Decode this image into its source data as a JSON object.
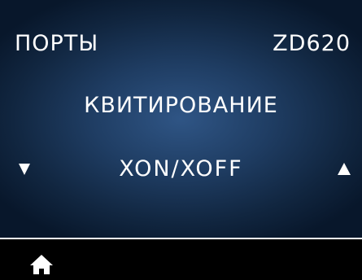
{
  "header": {
    "section": "ПОРТЫ",
    "model": "ZD620"
  },
  "menu": {
    "title": "КВИТИРОВАНИЕ",
    "value": "XON/XOFF"
  },
  "icons": {
    "left_arrow": "down-triangle-icon",
    "right_arrow": "up-triangle-icon",
    "home": "home-icon"
  },
  "colors": {
    "text": "#ffffff",
    "background_center": "#2f5585",
    "background_edge": "#08172b",
    "bar": "#000000"
  }
}
